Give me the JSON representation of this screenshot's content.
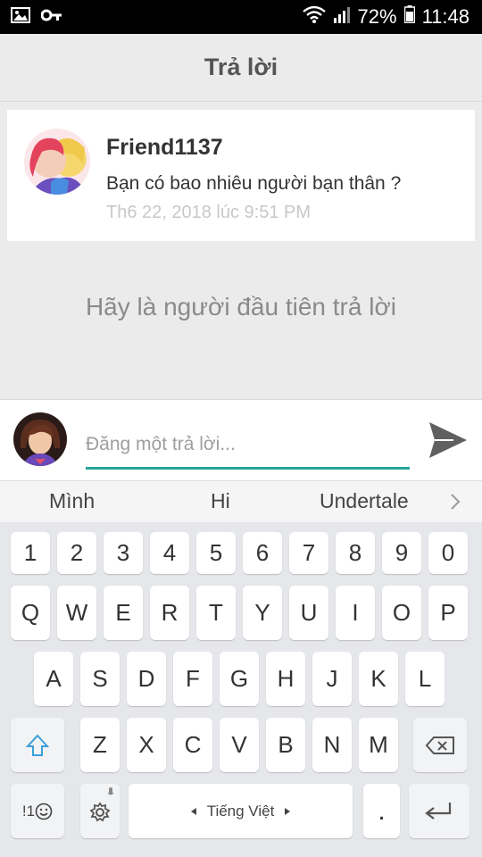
{
  "status": {
    "battery_percent": "72%",
    "time": "11:48",
    "left_icons": [
      "image-icon",
      "key-icon"
    ],
    "right_icons": [
      "wifi-icon",
      "signal-icon",
      "battery-icon"
    ]
  },
  "header": {
    "title": "Trả lời"
  },
  "question": {
    "author": "Friend1137",
    "text": "Bạn có bao nhiêu người bạn thân ?",
    "timestamp": "Th6 22, 2018 lúc 9:51 PM"
  },
  "empty_state": "Hãy là người đầu tiên trả lời",
  "reply": {
    "placeholder": "Đăng một trả lời...",
    "value": ""
  },
  "suggestions": [
    "Mình",
    "Hi",
    "Undertale"
  ],
  "keyboard": {
    "numbers": [
      "1",
      "2",
      "3",
      "4",
      "5",
      "6",
      "7",
      "8",
      "9",
      "0"
    ],
    "row1": [
      "Q",
      "W",
      "E",
      "R",
      "T",
      "Y",
      "U",
      "I",
      "O",
      "P"
    ],
    "row2": [
      "A",
      "S",
      "D",
      "F",
      "G",
      "H",
      "J",
      "K",
      "L"
    ],
    "row3": [
      "Z",
      "X",
      "C",
      "V",
      "B",
      "N",
      "M"
    ],
    "symbols_label": "!1",
    "space_label": "Tiếng Việt",
    "period_label": "."
  },
  "colors": {
    "accent": "#26a69a",
    "background": "#ebebeb"
  }
}
